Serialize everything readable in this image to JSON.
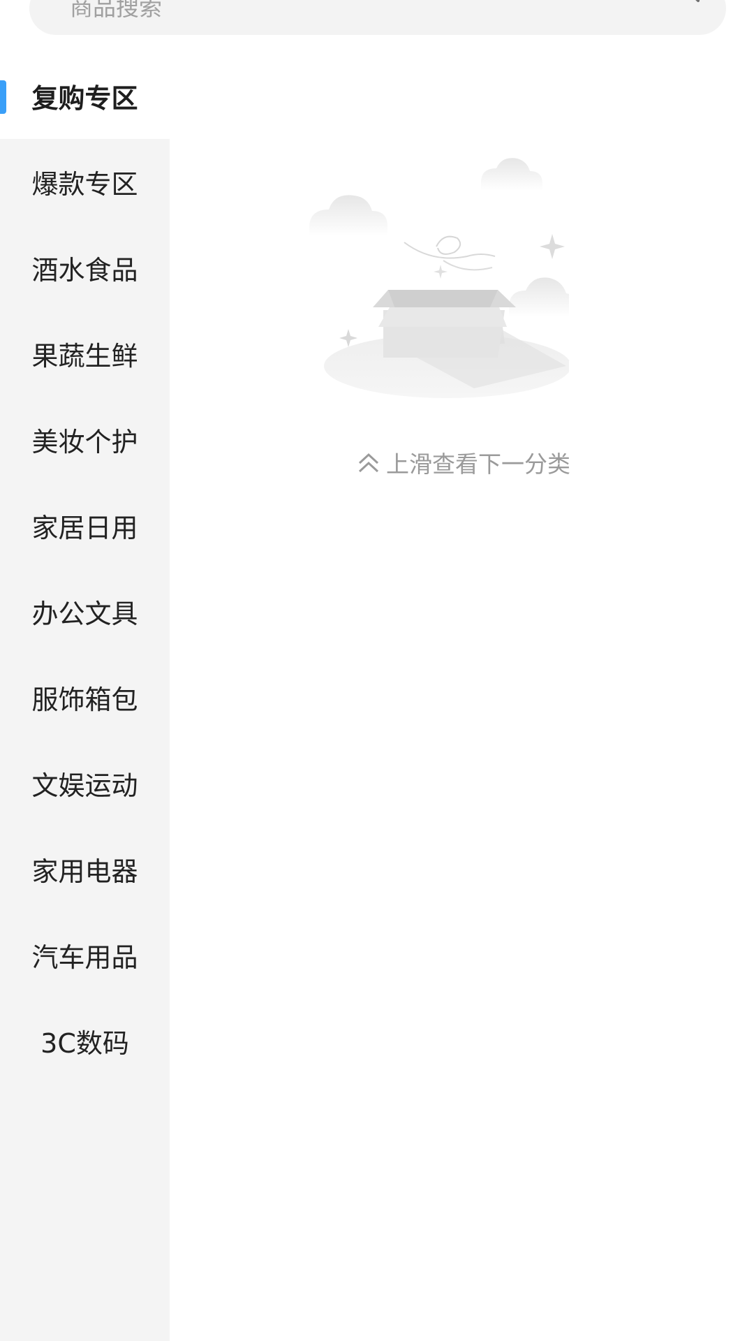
{
  "search": {
    "placeholder": "商品搜索",
    "value": "",
    "icon": "search-icon"
  },
  "sidebar": {
    "active_index": 0,
    "accent_color": "#3a9ff8",
    "items": [
      {
        "label": "复购专区"
      },
      {
        "label": "爆款专区"
      },
      {
        "label": "酒水食品"
      },
      {
        "label": "果蔬生鲜"
      },
      {
        "label": "美妆个护"
      },
      {
        "label": "家居日用"
      },
      {
        "label": "办公文具"
      },
      {
        "label": "服饰箱包"
      },
      {
        "label": "文娱运动"
      },
      {
        "label": "家用电器"
      },
      {
        "label": "汽车用品"
      },
      {
        "label": "3C数码"
      }
    ]
  },
  "main": {
    "empty_illustration": "empty-box-icon",
    "tip_icon": "chevron-up-icon",
    "tip_text": "上滑查看下一分类"
  }
}
